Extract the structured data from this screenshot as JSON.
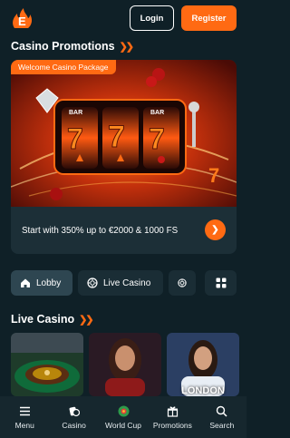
{
  "header": {
    "logo_icon": "flame-e-logo",
    "login_label": "Login",
    "register_label": "Register",
    "accent": "#ff6a13"
  },
  "promotions": {
    "title": "Casino Promotions",
    "card": {
      "badge": "Welcome Casino Package",
      "image_icon": "slot-machine-777",
      "text": "Start with 350% up to €2000 & 1000 FS"
    }
  },
  "tabs": [
    {
      "label": "Lobby",
      "icon": "home-icon",
      "active": true
    },
    {
      "label": "Live Casino",
      "icon": "chip-icon",
      "active": false
    },
    {
      "label": "",
      "icon": "chip-icon",
      "active": false
    }
  ],
  "grid_button_icon": "grid-icon",
  "live_casino": {
    "title": "Live Casino",
    "tiles": [
      {
        "label": "",
        "kind": "roulette"
      },
      {
        "label": "",
        "kind": "dealer"
      },
      {
        "label": "LONDON",
        "kind": "dealer"
      }
    ]
  },
  "bottom_nav": [
    {
      "label": "Menu",
      "icon": "menu-icon"
    },
    {
      "label": "Casino",
      "icon": "casino-chips-icon"
    },
    {
      "label": "World Cup",
      "icon": "football-icon"
    },
    {
      "label": "Promotions",
      "icon": "gift-icon"
    },
    {
      "label": "Search",
      "icon": "search-icon"
    }
  ]
}
